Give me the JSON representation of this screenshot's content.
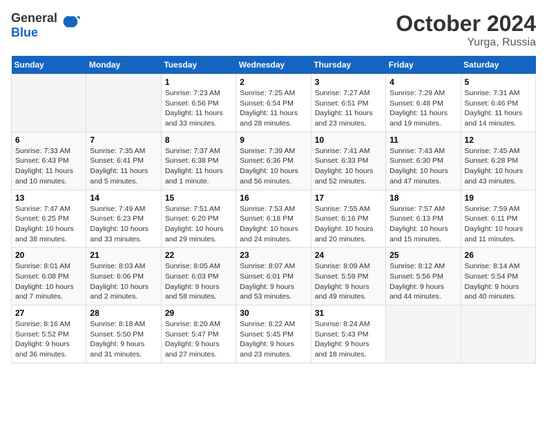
{
  "logo": {
    "general": "General",
    "blue": "Blue"
  },
  "title": "October 2024",
  "subtitle": "Yurga, Russia",
  "weekdays": [
    "Sunday",
    "Monday",
    "Tuesday",
    "Wednesday",
    "Thursday",
    "Friday",
    "Saturday"
  ],
  "weeks": [
    [
      {
        "day": "",
        "sunrise": "",
        "sunset": "",
        "daylight": ""
      },
      {
        "day": "",
        "sunrise": "",
        "sunset": "",
        "daylight": ""
      },
      {
        "day": "1",
        "sunrise": "Sunrise: 7:23 AM",
        "sunset": "Sunset: 6:56 PM",
        "daylight": "Daylight: 11 hours and 33 minutes."
      },
      {
        "day": "2",
        "sunrise": "Sunrise: 7:25 AM",
        "sunset": "Sunset: 6:54 PM",
        "daylight": "Daylight: 11 hours and 28 minutes."
      },
      {
        "day": "3",
        "sunrise": "Sunrise: 7:27 AM",
        "sunset": "Sunset: 6:51 PM",
        "daylight": "Daylight: 11 hours and 23 minutes."
      },
      {
        "day": "4",
        "sunrise": "Sunrise: 7:29 AM",
        "sunset": "Sunset: 6:48 PM",
        "daylight": "Daylight: 11 hours and 19 minutes."
      },
      {
        "day": "5",
        "sunrise": "Sunrise: 7:31 AM",
        "sunset": "Sunset: 6:46 PM",
        "daylight": "Daylight: 11 hours and 14 minutes."
      }
    ],
    [
      {
        "day": "6",
        "sunrise": "Sunrise: 7:33 AM",
        "sunset": "Sunset: 6:43 PM",
        "daylight": "Daylight: 11 hours and 10 minutes."
      },
      {
        "day": "7",
        "sunrise": "Sunrise: 7:35 AM",
        "sunset": "Sunset: 6:41 PM",
        "daylight": "Daylight: 11 hours and 5 minutes."
      },
      {
        "day": "8",
        "sunrise": "Sunrise: 7:37 AM",
        "sunset": "Sunset: 6:38 PM",
        "daylight": "Daylight: 11 hours and 1 minute."
      },
      {
        "day": "9",
        "sunrise": "Sunrise: 7:39 AM",
        "sunset": "Sunset: 6:36 PM",
        "daylight": "Daylight: 10 hours and 56 minutes."
      },
      {
        "day": "10",
        "sunrise": "Sunrise: 7:41 AM",
        "sunset": "Sunset: 6:33 PM",
        "daylight": "Daylight: 10 hours and 52 minutes."
      },
      {
        "day": "11",
        "sunrise": "Sunrise: 7:43 AM",
        "sunset": "Sunset: 6:30 PM",
        "daylight": "Daylight: 10 hours and 47 minutes."
      },
      {
        "day": "12",
        "sunrise": "Sunrise: 7:45 AM",
        "sunset": "Sunset: 6:28 PM",
        "daylight": "Daylight: 10 hours and 43 minutes."
      }
    ],
    [
      {
        "day": "13",
        "sunrise": "Sunrise: 7:47 AM",
        "sunset": "Sunset: 6:25 PM",
        "daylight": "Daylight: 10 hours and 38 minutes."
      },
      {
        "day": "14",
        "sunrise": "Sunrise: 7:49 AM",
        "sunset": "Sunset: 6:23 PM",
        "daylight": "Daylight: 10 hours and 33 minutes."
      },
      {
        "day": "15",
        "sunrise": "Sunrise: 7:51 AM",
        "sunset": "Sunset: 6:20 PM",
        "daylight": "Daylight: 10 hours and 29 minutes."
      },
      {
        "day": "16",
        "sunrise": "Sunrise: 7:53 AM",
        "sunset": "Sunset: 6:18 PM",
        "daylight": "Daylight: 10 hours and 24 minutes."
      },
      {
        "day": "17",
        "sunrise": "Sunrise: 7:55 AM",
        "sunset": "Sunset: 6:16 PM",
        "daylight": "Daylight: 10 hours and 20 minutes."
      },
      {
        "day": "18",
        "sunrise": "Sunrise: 7:57 AM",
        "sunset": "Sunset: 6:13 PM",
        "daylight": "Daylight: 10 hours and 15 minutes."
      },
      {
        "day": "19",
        "sunrise": "Sunrise: 7:59 AM",
        "sunset": "Sunset: 6:11 PM",
        "daylight": "Daylight: 10 hours and 11 minutes."
      }
    ],
    [
      {
        "day": "20",
        "sunrise": "Sunrise: 8:01 AM",
        "sunset": "Sunset: 6:08 PM",
        "daylight": "Daylight: 10 hours and 7 minutes."
      },
      {
        "day": "21",
        "sunrise": "Sunrise: 8:03 AM",
        "sunset": "Sunset: 6:06 PM",
        "daylight": "Daylight: 10 hours and 2 minutes."
      },
      {
        "day": "22",
        "sunrise": "Sunrise: 8:05 AM",
        "sunset": "Sunset: 6:03 PM",
        "daylight": "Daylight: 9 hours and 58 minutes."
      },
      {
        "day": "23",
        "sunrise": "Sunrise: 8:07 AM",
        "sunset": "Sunset: 6:01 PM",
        "daylight": "Daylight: 9 hours and 53 minutes."
      },
      {
        "day": "24",
        "sunrise": "Sunrise: 8:09 AM",
        "sunset": "Sunset: 5:59 PM",
        "daylight": "Daylight: 9 hours and 49 minutes."
      },
      {
        "day": "25",
        "sunrise": "Sunrise: 8:12 AM",
        "sunset": "Sunset: 5:56 PM",
        "daylight": "Daylight: 9 hours and 44 minutes."
      },
      {
        "day": "26",
        "sunrise": "Sunrise: 8:14 AM",
        "sunset": "Sunset: 5:54 PM",
        "daylight": "Daylight: 9 hours and 40 minutes."
      }
    ],
    [
      {
        "day": "27",
        "sunrise": "Sunrise: 8:16 AM",
        "sunset": "Sunset: 5:52 PM",
        "daylight": "Daylight: 9 hours and 36 minutes."
      },
      {
        "day": "28",
        "sunrise": "Sunrise: 8:18 AM",
        "sunset": "Sunset: 5:50 PM",
        "daylight": "Daylight: 9 hours and 31 minutes."
      },
      {
        "day": "29",
        "sunrise": "Sunrise: 8:20 AM",
        "sunset": "Sunset: 5:47 PM",
        "daylight": "Daylight: 9 hours and 27 minutes."
      },
      {
        "day": "30",
        "sunrise": "Sunrise: 8:22 AM",
        "sunset": "Sunset: 5:45 PM",
        "daylight": "Daylight: 9 hours and 23 minutes."
      },
      {
        "day": "31",
        "sunrise": "Sunrise: 8:24 AM",
        "sunset": "Sunset: 5:43 PM",
        "daylight": "Daylight: 9 hours and 18 minutes."
      },
      {
        "day": "",
        "sunrise": "",
        "sunset": "",
        "daylight": ""
      },
      {
        "day": "",
        "sunrise": "",
        "sunset": "",
        "daylight": ""
      }
    ]
  ]
}
